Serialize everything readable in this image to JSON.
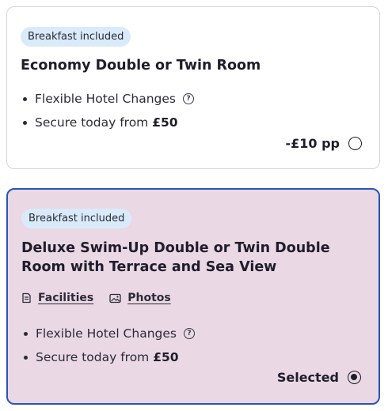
{
  "rooms": [
    {
      "badge": "Breakfast included",
      "title": "Economy Double or Twin Room",
      "features": {
        "flexible": "Flexible Hotel Changes",
        "secure_prefix": "Secure today from ",
        "secure_amount": "£50"
      },
      "price_label": "-£10 pp",
      "selected": false
    },
    {
      "badge": "Breakfast included",
      "title": "Deluxe Swim-Up Double or Twin Double Room with Terrace and Sea View",
      "links": {
        "facilities": "Facilities",
        "photos": "Photos"
      },
      "features": {
        "flexible": "Flexible Hotel Changes",
        "secure_prefix": "Secure today from ",
        "secure_amount": "£50"
      },
      "price_label": "Selected",
      "selected": true
    }
  ],
  "colors": {
    "selected_border": "#2855b8",
    "selected_background": "#ead8e5",
    "badge_background": "#d9ebfa"
  }
}
